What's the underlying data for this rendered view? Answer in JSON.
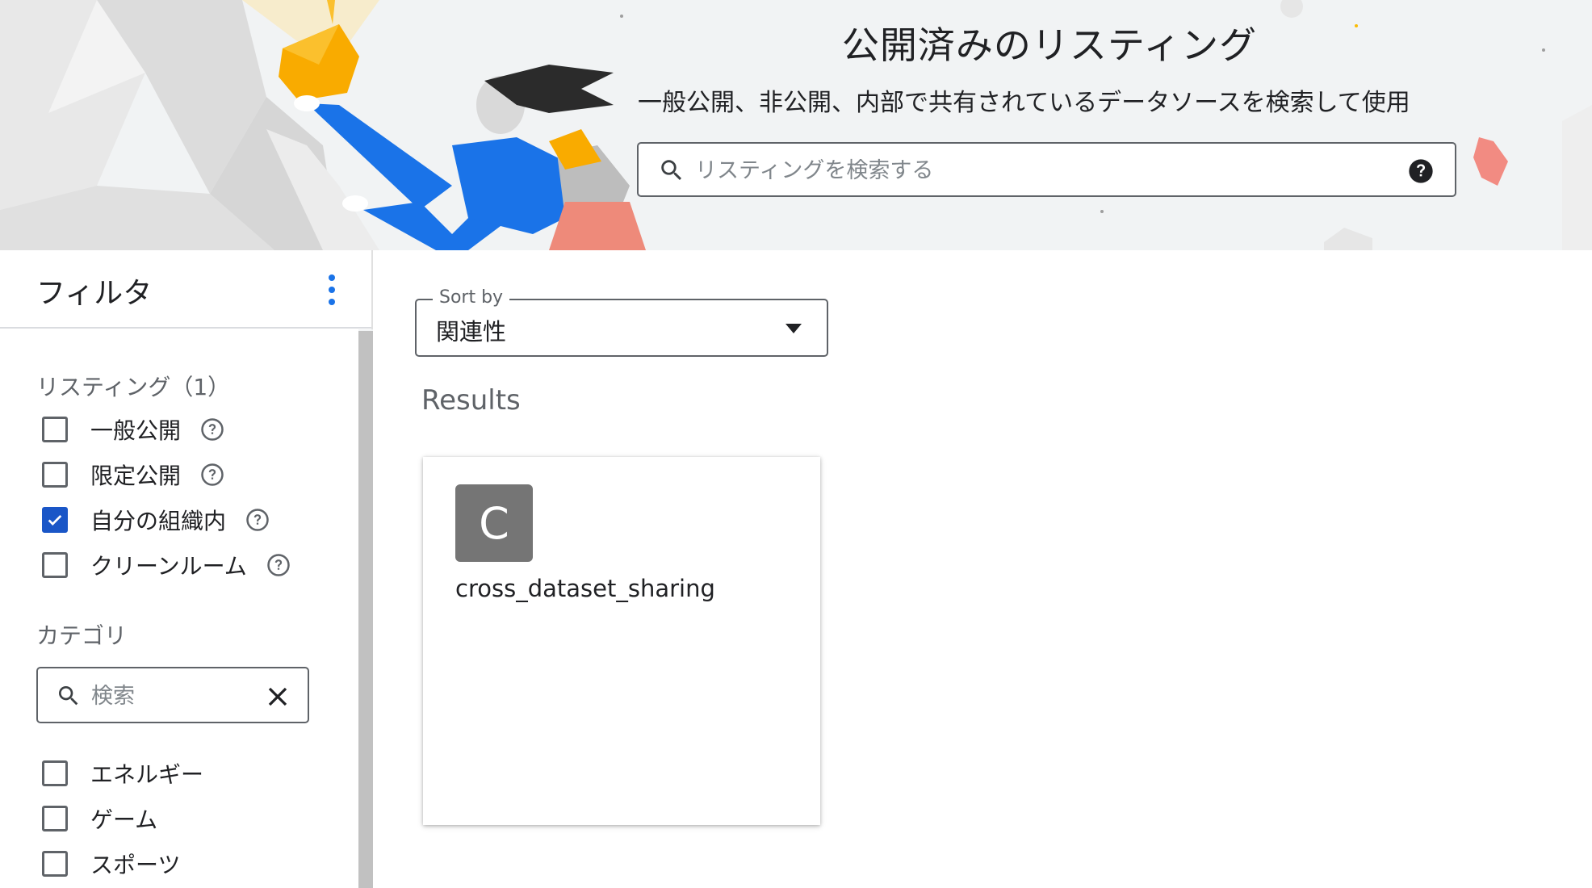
{
  "hero": {
    "title": "公開済みのリスティング",
    "subtitle": "一般公開、非公開、内部で共有されているデータソースを検索して使用",
    "search": {
      "placeholder": "リスティングを検索する"
    }
  },
  "sidebar": {
    "title": "フィルタ",
    "listings": {
      "title": "リスティング（1）",
      "items": [
        {
          "label": "一般公開",
          "checked": false
        },
        {
          "label": "限定公開",
          "checked": false
        },
        {
          "label": "自分の組織内",
          "checked": true
        },
        {
          "label": "クリーンルーム",
          "checked": false
        }
      ]
    },
    "categories": {
      "title": "カテゴリ",
      "search_placeholder": "検索",
      "items": [
        {
          "label": "エネルギー",
          "checked": false
        },
        {
          "label": "ゲーム",
          "checked": false
        },
        {
          "label": "スポーツ",
          "checked": false
        }
      ]
    }
  },
  "main": {
    "sort": {
      "label": "Sort by",
      "value": "関連性"
    },
    "results_title": "Results",
    "results": [
      {
        "avatar_letter": "C",
        "title": "cross_dataset_sharing"
      }
    ]
  },
  "colors": {
    "accent": "#1a56c7",
    "avatar": "#757575",
    "hero_bg": "#f1f3f4"
  }
}
